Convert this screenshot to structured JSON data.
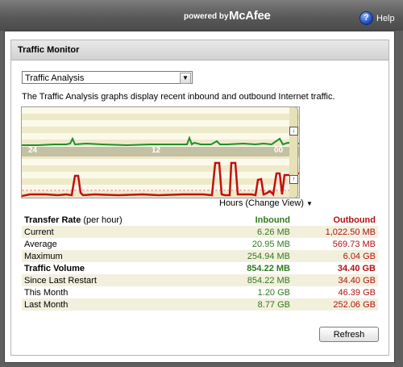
{
  "topbar": {
    "powered_by": "powered by",
    "brand": "McAfee",
    "help_label": "Help"
  },
  "panel": {
    "title": "Traffic Monitor",
    "view_select": {
      "selected": "Traffic Analysis"
    },
    "description": "The Traffic Analysis graphs display recent inbound and outbound Internet traffic.",
    "graph": {
      "axis_labels": [
        "24",
        "12",
        "00"
      ],
      "inbound_color": "#1f8f2a",
      "outbound_color": "#c40f0f",
      "hours_link": "Hours (Change View)"
    },
    "stats": {
      "header": {
        "label": "Transfer Rate",
        "sublabel": "(per hour)",
        "inbound": "Inbound",
        "outbound": "Outbound"
      },
      "rows": [
        {
          "label": "Current",
          "inbound": "6.26 MB",
          "outbound": "1,022.50 MB"
        },
        {
          "label": "Average",
          "inbound": "20.95 MB",
          "outbound": "569.73 MB"
        },
        {
          "label": "Maximum",
          "inbound": "254.94 MB",
          "outbound": "6.04 GB"
        }
      ],
      "volume_header": {
        "label": "Traffic Volume",
        "inbound": "854.22 MB",
        "outbound": "34.40 GB"
      },
      "volume_rows": [
        {
          "label": "Since Last Restart",
          "inbound": "854.22 MB",
          "outbound": "34.40 GB"
        },
        {
          "label": "This Month",
          "inbound": "1.20 GB",
          "outbound": "46.39 GB"
        },
        {
          "label": "Last Month",
          "inbound": "8.77 GB",
          "outbound": "252.06 GB"
        }
      ]
    },
    "refresh_label": "Refresh"
  }
}
